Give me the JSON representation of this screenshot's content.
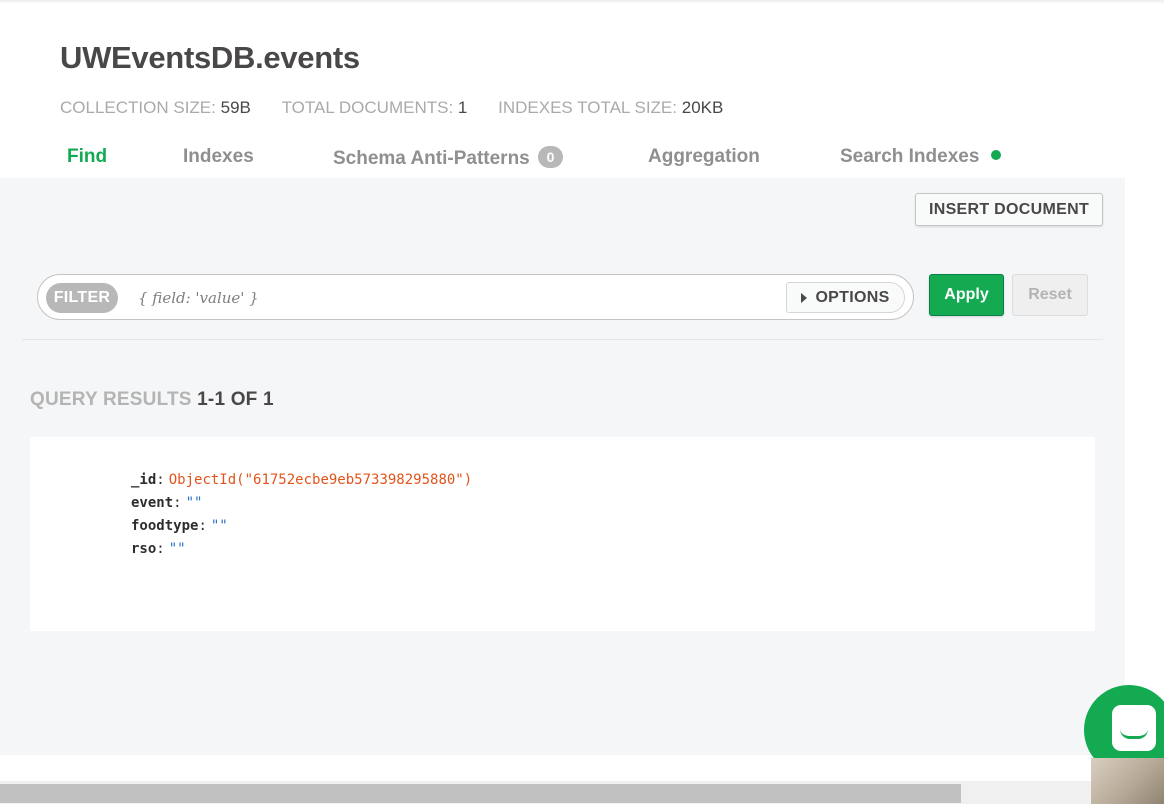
{
  "collection": {
    "title": "UWEventsDB.events",
    "stats": {
      "collection_size_label": "COLLECTION SIZE:",
      "collection_size_value": "59B",
      "total_documents_label": "TOTAL DOCUMENTS:",
      "total_documents_value": "1",
      "indexes_total_size_label": "INDEXES TOTAL SIZE:",
      "indexes_total_size_value": "20KB"
    }
  },
  "tabs": [
    {
      "label": "Find",
      "active": true
    },
    {
      "label": "Indexes"
    },
    {
      "label": "Schema Anti-Patterns",
      "count": "0"
    },
    {
      "label": "Aggregation"
    },
    {
      "label": "Search Indexes",
      "status_dot_color": "#13aa52"
    }
  ],
  "toolbar": {
    "insert_document_label": "INSERT DOCUMENT"
  },
  "filter": {
    "label": "FILTER",
    "placeholder": "{ field: 'value' }",
    "value": "",
    "options_label": "OPTIONS",
    "apply_label": "Apply",
    "reset_label": "Reset"
  },
  "results": {
    "label": "QUERY RESULTS",
    "range": "1-1 OF 1"
  },
  "document": {
    "fields": [
      {
        "key": "_id",
        "value": "ObjectId(\"61752ecbe9eb573398295880\")"
      },
      {
        "key": "event",
        "value": "\"\""
      },
      {
        "key": "foodtype",
        "value": "\"\""
      },
      {
        "key": "rso",
        "value": "\"\""
      }
    ]
  },
  "icons": {
    "chat": "chat-icon",
    "options_caret": "caret-right-icon"
  },
  "colors": {
    "accent": "#13aa52",
    "objectid": "#e2541b",
    "string_value": "#2b72c9"
  }
}
